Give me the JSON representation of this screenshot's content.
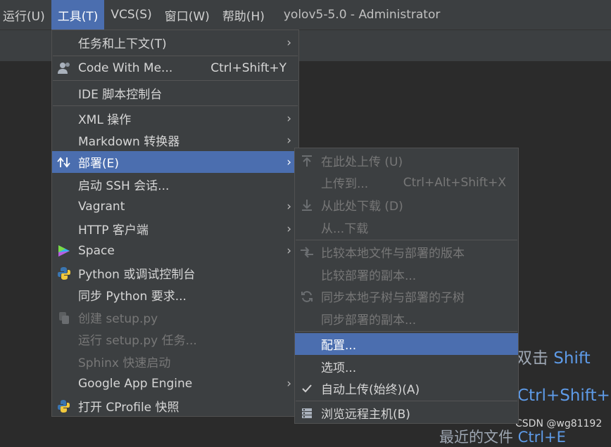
{
  "menubar": {
    "items": [
      {
        "label": "运行(U)"
      },
      {
        "label": "工具(T)"
      },
      {
        "label": "VCS(S)"
      },
      {
        "label": "窗口(W)"
      },
      {
        "label": "帮助(H)"
      }
    ],
    "window_title": "yolov5-5.0 - Administrator"
  },
  "tools_menu": {
    "items": [
      {
        "label": "任务和上下文(T)"
      },
      {
        "label": "Code With Me...",
        "shortcut": "Ctrl+Shift+Y"
      },
      {
        "label": "IDE 脚本控制台"
      },
      {
        "label": "XML 操作"
      },
      {
        "label": "Markdown 转换器"
      },
      {
        "label": "部署(E)"
      },
      {
        "label": "启动 SSH 会话..."
      },
      {
        "label": "Vagrant"
      },
      {
        "label": "HTTP 客户端"
      },
      {
        "label": "Space"
      },
      {
        "label": "Python 或调试控制台"
      },
      {
        "label": "同步 Python 要求..."
      },
      {
        "label": "创建 setup.py"
      },
      {
        "label": "运行 setup.py 任务..."
      },
      {
        "label": "Sphinx 快速启动"
      },
      {
        "label": "Google App Engine"
      },
      {
        "label": "打开 CProfile 快照"
      }
    ]
  },
  "deploy_menu": {
    "items": [
      {
        "label": "在此处上传 (U)"
      },
      {
        "label": "上传到...",
        "shortcut": "Ctrl+Alt+Shift+X"
      },
      {
        "label": "从此处下载 (D)"
      },
      {
        "label": "从...下载"
      },
      {
        "label": "比较本地文件与部署的版本"
      },
      {
        "label": "比较部署的副本..."
      },
      {
        "label": "同步本地子树与部署的子树"
      },
      {
        "label": "同步部署的副本..."
      },
      {
        "label": "配置..."
      },
      {
        "label": "选项..."
      },
      {
        "label": "自动上传(始终)(A)"
      },
      {
        "label": "浏览远程主机(B)"
      }
    ]
  },
  "background": {
    "hint1_a": "双击",
    "hint1_b": " Shift",
    "hint2": "Ctrl+Shift+N",
    "hint3_a": "最近的文件",
    "hint3_b": " Ctrl+E"
  },
  "watermark": "CSDN @wg81192",
  "colors": {
    "accent": "#4b6eaf",
    "menu_bg": "#3c3f41",
    "editor_bg": "#2b2b2b",
    "link_blue": "#5e9be8"
  },
  "icons": {
    "code_with_me": "person-icon",
    "deploy": "up-down-arrows-icon",
    "space": "space-logo-icon",
    "python": "python-logo-icon",
    "setup": "package-icon",
    "cprofile": "python-profile-icon",
    "upload_here": "upload-icon",
    "download_here": "download-icon",
    "compare": "compare-arrows-icon",
    "sync": "sync-icon",
    "check": "check-icon",
    "remote_host": "server-icon",
    "submenu": "chevron-right-icon"
  }
}
